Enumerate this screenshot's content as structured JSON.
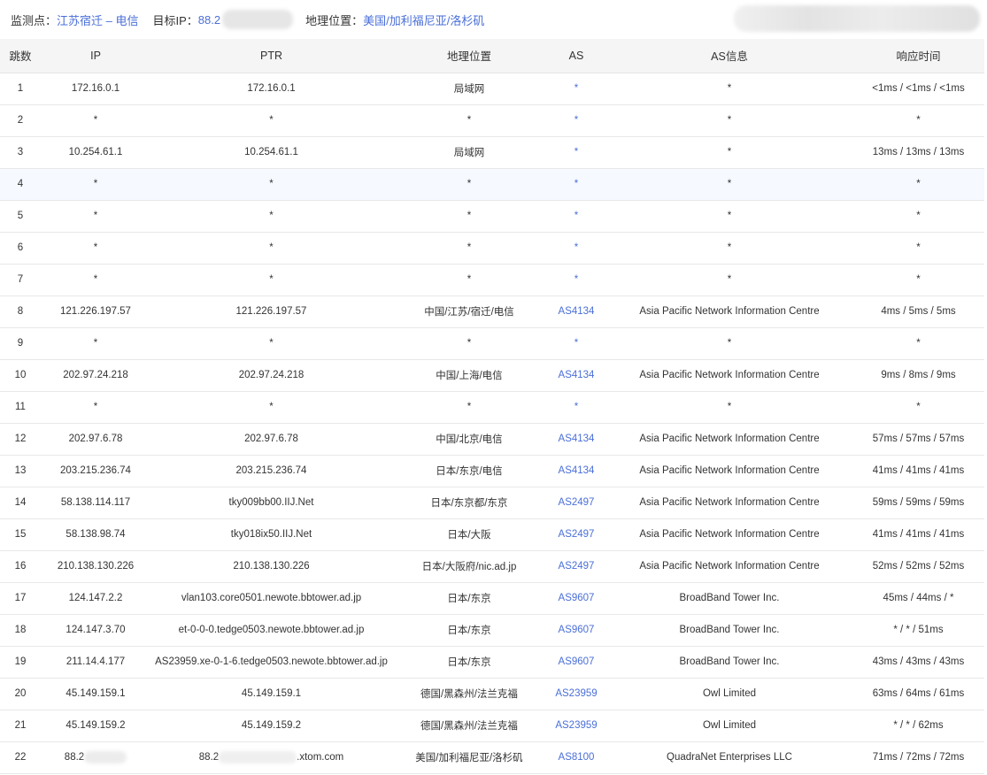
{
  "header": {
    "monitor_label": "监测点：",
    "monitor_value": "江苏宿迁 – 电信",
    "target_label": "目标IP：",
    "target_value": "88.2",
    "geo_label": "地理位置：",
    "geo_value": "美国/加利福尼亚/洛杉矶"
  },
  "columns": [
    "跳数",
    "IP",
    "PTR",
    "地理位置",
    "AS",
    "AS信息",
    "响应时间"
  ],
  "rows": [
    {
      "hop": "1",
      "ip": "172.16.0.1",
      "ptr": "172.16.0.1",
      "geo": "局域网",
      "as": "*",
      "asinfo": "*",
      "rt": "<1ms / <1ms / <1ms"
    },
    {
      "hop": "2",
      "ip": "*",
      "ptr": "*",
      "geo": "*",
      "as": "*",
      "asinfo": "*",
      "rt": "*"
    },
    {
      "hop": "3",
      "ip": "10.254.61.1",
      "ptr": "10.254.61.1",
      "geo": "局域网",
      "as": "*",
      "asinfo": "*",
      "rt": "13ms / 13ms / 13ms"
    },
    {
      "hop": "4",
      "ip": "*",
      "ptr": "*",
      "geo": "*",
      "as": "*",
      "asinfo": "*",
      "rt": "*"
    },
    {
      "hop": "5",
      "ip": "*",
      "ptr": "*",
      "geo": "*",
      "as": "*",
      "asinfo": "*",
      "rt": "*"
    },
    {
      "hop": "6",
      "ip": "*",
      "ptr": "*",
      "geo": "*",
      "as": "*",
      "asinfo": "*",
      "rt": "*"
    },
    {
      "hop": "7",
      "ip": "*",
      "ptr": "*",
      "geo": "*",
      "as": "*",
      "asinfo": "*",
      "rt": "*"
    },
    {
      "hop": "8",
      "ip": "121.226.197.57",
      "ptr": "121.226.197.57",
      "geo": "中国/江苏/宿迁/电信",
      "as": "AS4134",
      "asinfo": "Asia Pacific Network Information Centre",
      "rt": "4ms / 5ms / 5ms"
    },
    {
      "hop": "9",
      "ip": "*",
      "ptr": "*",
      "geo": "*",
      "as": "*",
      "asinfo": "*",
      "rt": "*"
    },
    {
      "hop": "10",
      "ip": "202.97.24.218",
      "ptr": "202.97.24.218",
      "geo": "中国/上海/电信",
      "as": "AS4134",
      "asinfo": "Asia Pacific Network Information Centre",
      "rt": "9ms / 8ms / 9ms"
    },
    {
      "hop": "11",
      "ip": "*",
      "ptr": "*",
      "geo": "*",
      "as": "*",
      "asinfo": "*",
      "rt": "*"
    },
    {
      "hop": "12",
      "ip": "202.97.6.78",
      "ptr": "202.97.6.78",
      "geo": "中国/北京/电信",
      "as": "AS4134",
      "asinfo": "Asia Pacific Network Information Centre",
      "rt": "57ms / 57ms / 57ms"
    },
    {
      "hop": "13",
      "ip": "203.215.236.74",
      "ptr": "203.215.236.74",
      "geo": "日本/东京/电信",
      "as": "AS4134",
      "asinfo": "Asia Pacific Network Information Centre",
      "rt": "41ms / 41ms / 41ms"
    },
    {
      "hop": "14",
      "ip": "58.138.114.117",
      "ptr": "tky009bb00.IIJ.Net",
      "geo": "日本/东京都/东京",
      "as": "AS2497",
      "asinfo": "Asia Pacific Network Information Centre",
      "rt": "59ms / 59ms / 59ms"
    },
    {
      "hop": "15",
      "ip": "58.138.98.74",
      "ptr": "tky018ix50.IIJ.Net",
      "geo": "日本/大阪",
      "as": "AS2497",
      "asinfo": "Asia Pacific Network Information Centre",
      "rt": "41ms / 41ms / 41ms"
    },
    {
      "hop": "16",
      "ip": "210.138.130.226",
      "ptr": "210.138.130.226",
      "geo": "日本/大阪府/nic.ad.jp",
      "as": "AS2497",
      "asinfo": "Asia Pacific Network Information Centre",
      "rt": "52ms / 52ms / 52ms"
    },
    {
      "hop": "17",
      "ip": "124.147.2.2",
      "ptr": "vlan103.core0501.newote.bbtower.ad.jp",
      "geo": "日本/东京",
      "as": "AS9607",
      "asinfo": "BroadBand Tower Inc.",
      "rt": "45ms / 44ms / *"
    },
    {
      "hop": "18",
      "ip": "124.147.3.70",
      "ptr": "et-0-0-0.tedge0503.newote.bbtower.ad.jp",
      "geo": "日本/东京",
      "as": "AS9607",
      "asinfo": "BroadBand Tower Inc.",
      "rt": "* / * / 51ms"
    },
    {
      "hop": "19",
      "ip": "211.14.4.177",
      "ptr": "AS23959.xe-0-1-6.tedge0503.newote.bbtower.ad.jp",
      "geo": "日本/东京",
      "as": "AS9607",
      "asinfo": "BroadBand Tower Inc.",
      "rt": "43ms / 43ms / 43ms"
    },
    {
      "hop": "20",
      "ip": "45.149.159.1",
      "ptr": "45.149.159.1",
      "geo": "德国/黑森州/法兰克福",
      "as": "AS23959",
      "asinfo": "Owl Limited",
      "rt": "63ms / 64ms / 61ms"
    },
    {
      "hop": "21",
      "ip": "45.149.159.2",
      "ptr": "45.149.159.2",
      "geo": "德国/黑森州/法兰克福",
      "as": "AS23959",
      "asinfo": "Owl Limited",
      "rt": "* / * / 62ms"
    },
    {
      "hop": "22",
      "ip": "88.2",
      "ptr": "88.2",
      "ptr_suffix": ".xtom.com",
      "geo": "美国/加利福尼亚/洛杉矶",
      "as": "AS8100",
      "asinfo": "QuadraNet Enterprises LLC",
      "rt": "71ms / 72ms / 72ms"
    }
  ],
  "highlight_row": 4,
  "colors": {
    "accent": "#4a6fd8",
    "header_bg": "#f5f5f5",
    "highlight_bg": "#f6f9ff"
  }
}
